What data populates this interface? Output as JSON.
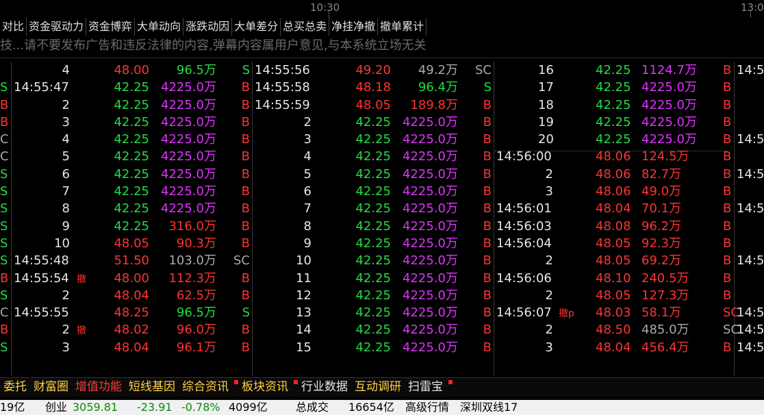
{
  "timeline": {
    "t1": "10:30",
    "t2": "13:0"
  },
  "tabs": [
    "对比",
    "资金驱动力",
    "资金博弈",
    "大单动向",
    "涨跌动因",
    "大单差分",
    "总买总卖",
    "净挂净撤",
    "撤单累计"
  ],
  "danmaku": "技...请不要发布广告和违反法律的内容,弹幕内容属用户意见,与本系统立场无关",
  "col1": [
    {
      "side": "",
      "time": "4",
      "che": "",
      "price": "48.00",
      "pc": "red",
      "amt": "96.5万",
      "ac": "green",
      "flag": "S",
      "fc": "green"
    },
    {
      "side": "S",
      "sc": "green",
      "time": "14:55:47",
      "che": "",
      "price": "42.25",
      "pc": "green",
      "amt": "4225.0万",
      "ac": "mag",
      "flag": "B",
      "fc": "red"
    },
    {
      "side": "B",
      "sc": "red",
      "time": "2",
      "che": "",
      "price": "42.25",
      "pc": "green",
      "amt": "4225.0万",
      "ac": "mag",
      "flag": "B",
      "fc": "red"
    },
    {
      "side": "B",
      "sc": "red",
      "time": "3",
      "che": "",
      "price": "42.25",
      "pc": "green",
      "amt": "4225.0万",
      "ac": "mag",
      "flag": "B",
      "fc": "red"
    },
    {
      "side": "C",
      "sc": "grey",
      "time": "4",
      "che": "",
      "price": "42.25",
      "pc": "green",
      "amt": "4225.0万",
      "ac": "mag",
      "flag": "B",
      "fc": "red"
    },
    {
      "side": "C",
      "sc": "grey",
      "time": "5",
      "che": "",
      "price": "42.25",
      "pc": "green",
      "amt": "4225.0万",
      "ac": "mag",
      "flag": "B",
      "fc": "red"
    },
    {
      "side": "S",
      "sc": "green",
      "time": "6",
      "che": "",
      "price": "42.25",
      "pc": "green",
      "amt": "4225.0万",
      "ac": "mag",
      "flag": "B",
      "fc": "red"
    },
    {
      "side": "S",
      "sc": "green",
      "time": "7",
      "che": "",
      "price": "42.25",
      "pc": "green",
      "amt": "4225.0万",
      "ac": "mag",
      "flag": "B",
      "fc": "red"
    },
    {
      "side": "S",
      "sc": "green",
      "time": "8",
      "che": "",
      "price": "42.25",
      "pc": "green",
      "amt": "4225.0万",
      "ac": "mag",
      "flag": "B",
      "fc": "red"
    },
    {
      "side": "S",
      "sc": "green",
      "time": "9",
      "che": "",
      "price": "42.25",
      "pc": "green",
      "amt": "316.0万",
      "ac": "red",
      "flag": "B",
      "fc": "red"
    },
    {
      "side": "S",
      "sc": "green",
      "time": "10",
      "che": "",
      "price": "48.05",
      "pc": "red",
      "amt": "90.3万",
      "ac": "red",
      "flag": "B",
      "fc": "red"
    },
    {
      "side": "S",
      "sc": "green",
      "time": "14:55:48",
      "che": "",
      "price": "51.50",
      "pc": "red",
      "amt": "103.0万",
      "ac": "grey",
      "flag": "SC",
      "fc": "grey"
    },
    {
      "side": "B",
      "sc": "red",
      "time": "14:55:54",
      "che": "撤",
      "price": "48.00",
      "pc": "red",
      "amt": "112.3万",
      "ac": "red",
      "flag": "B",
      "fc": "red"
    },
    {
      "side": "S",
      "sc": "green",
      "time": "2",
      "che": "",
      "price": "48.04",
      "pc": "red",
      "amt": "62.5万",
      "ac": "red",
      "flag": "B",
      "fc": "red"
    },
    {
      "side": "C",
      "sc": "grey",
      "time": "14:55:55",
      "che": "",
      "price": "48.25",
      "pc": "red",
      "amt": "96.5万",
      "ac": "green",
      "flag": "S",
      "fc": "green"
    },
    {
      "side": "B",
      "sc": "red",
      "time": "2",
      "che": "撤",
      "price": "48.02",
      "pc": "red",
      "amt": "96.0万",
      "ac": "red",
      "flag": "B",
      "fc": "red"
    },
    {
      "side": "S",
      "sc": "green",
      "time": "3",
      "che": "",
      "price": "48.04",
      "pc": "red",
      "amt": "96.1万",
      "ac": "red",
      "flag": "B",
      "fc": "red"
    }
  ],
  "col2": [
    {
      "time": "14:55:56",
      "price": "49.20",
      "pc": "red",
      "amt": "49.2万",
      "ac": "grey",
      "flag": "SC",
      "fc": "grey"
    },
    {
      "time": "14:55:58",
      "price": "48.18",
      "pc": "red",
      "amt": "96.4万",
      "ac": "green",
      "flag": "S",
      "fc": "green"
    },
    {
      "time": "14:55:59",
      "price": "48.05",
      "pc": "red",
      "amt": "189.8万",
      "ac": "red",
      "flag": "B",
      "fc": "red"
    },
    {
      "time": "2",
      "price": "42.25",
      "pc": "green",
      "amt": "4225.0万",
      "ac": "mag",
      "flag": "B",
      "fc": "red"
    },
    {
      "time": "3",
      "price": "42.25",
      "pc": "green",
      "amt": "4225.0万",
      "ac": "mag",
      "flag": "B",
      "fc": "red"
    },
    {
      "time": "4",
      "price": "42.25",
      "pc": "green",
      "amt": "4225.0万",
      "ac": "mag",
      "flag": "B",
      "fc": "red"
    },
    {
      "time": "5",
      "price": "42.25",
      "pc": "green",
      "amt": "4225.0万",
      "ac": "mag",
      "flag": "B",
      "fc": "red"
    },
    {
      "time": "6",
      "price": "42.25",
      "pc": "green",
      "amt": "4225.0万",
      "ac": "mag",
      "flag": "B",
      "fc": "red"
    },
    {
      "time": "7",
      "price": "42.25",
      "pc": "green",
      "amt": "4225.0万",
      "ac": "mag",
      "flag": "B",
      "fc": "red"
    },
    {
      "time": "8",
      "price": "42.25",
      "pc": "green",
      "amt": "4225.0万",
      "ac": "mag",
      "flag": "B",
      "fc": "red"
    },
    {
      "time": "9",
      "price": "42.25",
      "pc": "green",
      "amt": "4225.0万",
      "ac": "mag",
      "flag": "B",
      "fc": "red"
    },
    {
      "time": "10",
      "price": "42.25",
      "pc": "green",
      "amt": "4225.0万",
      "ac": "mag",
      "flag": "B",
      "fc": "red"
    },
    {
      "time": "11",
      "price": "42.25",
      "pc": "green",
      "amt": "4225.0万",
      "ac": "mag",
      "flag": "B",
      "fc": "red"
    },
    {
      "time": "12",
      "price": "42.25",
      "pc": "green",
      "amt": "4225.0万",
      "ac": "mag",
      "flag": "B",
      "fc": "red"
    },
    {
      "time": "13",
      "price": "42.25",
      "pc": "green",
      "amt": "4225.0万",
      "ac": "mag",
      "flag": "B",
      "fc": "red"
    },
    {
      "time": "14",
      "price": "42.25",
      "pc": "green",
      "amt": "4225.0万",
      "ac": "mag",
      "flag": "B",
      "fc": "red"
    },
    {
      "time": "15",
      "price": "42.25",
      "pc": "green",
      "amt": "4225.0万",
      "ac": "mag",
      "flag": "B",
      "fc": "red"
    }
  ],
  "col3": [
    {
      "time": "16",
      "che": "",
      "price": "42.25",
      "pc": "green",
      "amt": "1124.7万",
      "ac": "mag",
      "flag": "B",
      "fc": "red",
      "next": "B",
      "next_time": "14:5"
    },
    {
      "time": "17",
      "che": "",
      "price": "42.25",
      "pc": "green",
      "amt": "4225.0万",
      "ac": "mag",
      "flag": "B",
      "fc": "red",
      "next": "B",
      "next_time": ""
    },
    {
      "time": "18",
      "che": "",
      "price": "42.25",
      "pc": "green",
      "amt": "4225.0万",
      "ac": "mag",
      "flag": "B",
      "fc": "red",
      "next": "B",
      "next_time": ""
    },
    {
      "time": "19",
      "che": "",
      "price": "42.25",
      "pc": "green",
      "amt": "4225.0万",
      "ac": "mag",
      "flag": "B",
      "fc": "red",
      "next": "B",
      "next_time": ""
    },
    {
      "time": "20",
      "che": "",
      "price": "42.25",
      "pc": "green",
      "amt": "4225.0万",
      "ac": "mag",
      "flag": "B",
      "fc": "red",
      "next": "B",
      "next_time": "14:5"
    },
    {
      "time": "14:56:00",
      "che": "",
      "price": "48.06",
      "pc": "red",
      "amt": "124.5万",
      "ac": "red",
      "flag": "B",
      "fc": "red",
      "next": "B",
      "next_time": ""
    },
    {
      "time": "2",
      "che": "",
      "price": "48.06",
      "pc": "red",
      "amt": "82.7万",
      "ac": "red",
      "flag": "B",
      "fc": "red",
      "next": "B",
      "next_time": "14:5"
    },
    {
      "time": "3",
      "che": "",
      "price": "48.06",
      "pc": "red",
      "amt": "49.0万",
      "ac": "red",
      "flag": "B",
      "fc": "red",
      "next": "B",
      "next_time": ""
    },
    {
      "time": "14:56:01",
      "che": "",
      "price": "48.04",
      "pc": "red",
      "amt": "70.1万",
      "ac": "red",
      "flag": "B",
      "fc": "red",
      "next": "B",
      "next_time": "14:5"
    },
    {
      "time": "14:56:03",
      "che": "",
      "price": "48.08",
      "pc": "red",
      "amt": "96.2万",
      "ac": "red",
      "flag": "B",
      "fc": "red",
      "next": "B",
      "next_time": ""
    },
    {
      "time": "14:56:04",
      "che": "",
      "price": "48.05",
      "pc": "red",
      "amt": "92.3万",
      "ac": "red",
      "flag": "B",
      "fc": "red",
      "next": "B",
      "next_time": ""
    },
    {
      "time": "2",
      "che": "",
      "price": "48.05",
      "pc": "red",
      "amt": "69.2万",
      "ac": "red",
      "flag": "B",
      "fc": "red",
      "next": "B",
      "next_time": "14:5"
    },
    {
      "time": "14:56:06",
      "che": "",
      "price": "48.10",
      "pc": "red",
      "amt": "240.5万",
      "ac": "red",
      "flag": "B",
      "fc": "red",
      "next": "B",
      "next_time": ""
    },
    {
      "time": "2",
      "che": "",
      "price": "48.05",
      "pc": "red",
      "amt": "127.3万",
      "ac": "red",
      "flag": "B",
      "fc": "red",
      "next": "B",
      "next_time": ""
    },
    {
      "time": "14:56:07",
      "che": "撤p",
      "price": "48.03",
      "pc": "red",
      "amt": "58.1万",
      "ac": "red",
      "flag": "SC",
      "fc": "red",
      "next": "B",
      "next_time": "14:5"
    },
    {
      "time": "2",
      "che": "",
      "price": "48.50",
      "pc": "red",
      "amt": "485.0万",
      "ac": "grey",
      "flag": "SC",
      "fc": "grey",
      "next": "B",
      "next_time": "14:5"
    },
    {
      "time": "3",
      "che": "",
      "price": "48.04",
      "pc": "red",
      "amt": "456.4万",
      "ac": "red",
      "flag": "B",
      "fc": "red",
      "next": "B",
      "next_time": "14:5"
    }
  ],
  "bottom_tabs": [
    {
      "label": "委托",
      "color": "#ffd24a",
      "dot": false
    },
    {
      "label": "财富圈",
      "color": "#ffd24a",
      "dot": false
    },
    {
      "label": "增值功能",
      "color": "#ff3b3b",
      "dot": false
    },
    {
      "label": "短线基因",
      "color": "#ffd24a",
      "dot": false
    },
    {
      "label": "综合资讯",
      "color": "#ffd24a",
      "dot": true
    },
    {
      "label": "板块资讯",
      "color": "#ffd24a",
      "dot": true
    },
    {
      "label": "行业数据",
      "color": "#e6e6e6",
      "dot": false
    },
    {
      "label": "互动调研",
      "color": "#ffd24a",
      "dot": false
    },
    {
      "label": "扫雷宝",
      "color": "#e6e6e6",
      "dot": true
    }
  ],
  "status": {
    "left_amt": "19亿",
    "chuangye_label": "创业",
    "chuangye_val": "3059.81",
    "chg": "-23.91",
    "pct": "-0.78%",
    "vol": "4099亿",
    "total_label": "总成交",
    "total_val": "16654亿",
    "advanced": "高级行情",
    "line": "深圳双线17"
  }
}
